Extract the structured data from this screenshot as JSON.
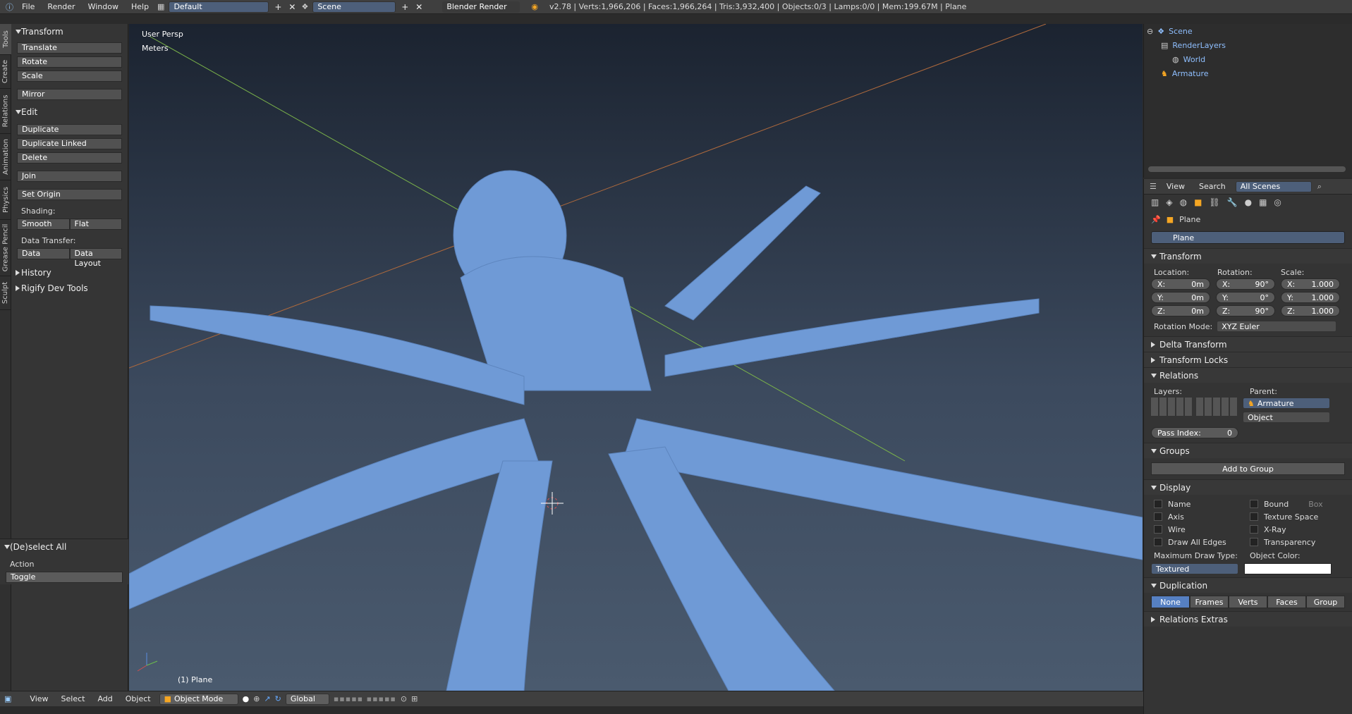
{
  "topbar": {
    "menus": [
      "File",
      "Render",
      "Window",
      "Help"
    ],
    "screen_layout": "Default",
    "scene": "Scene",
    "engine": "Blender Render",
    "stats": "v2.78 | Verts:1,966,206 | Faces:1,966,264 | Tris:3,932,400 | Objects:0/3 | Lamps:0/0 | Mem:199.67M | Plane"
  },
  "tabs": [
    "Tools",
    "Create",
    "Relations",
    "Animation",
    "Physics",
    "Grease Pencil",
    "Sculpt"
  ],
  "toolshelf": {
    "transform_title": "Transform",
    "translate": "Translate",
    "rotate": "Rotate",
    "scale": "Scale",
    "mirror": "Mirror",
    "edit_title": "Edit",
    "duplicate": "Duplicate",
    "duplicate_linked": "Duplicate Linked",
    "delete": "Delete",
    "join": "Join",
    "set_origin": "Set Origin",
    "shading_label": "Shading:",
    "smooth": "Smooth",
    "flat": "Flat",
    "data_transfer_label": "Data Transfer:",
    "data": "Data",
    "data_layout": "Data Layout",
    "history": "History",
    "rigify": "Rigify Dev Tools",
    "deselect_title": "(De)select All",
    "action_label": "Action",
    "action_value": "Toggle"
  },
  "viewport": {
    "view_name": "User Persp",
    "units": "Meters",
    "object_label": "(1) Plane"
  },
  "bottombar": {
    "menus": [
      "View",
      "Select",
      "Add",
      "Object"
    ],
    "mode": "Object Mode",
    "orientation": "Global"
  },
  "outliner": {
    "items": [
      "Scene",
      "RenderLayers",
      "World",
      "Armature"
    ]
  },
  "props": {
    "view": "View",
    "search": "Search",
    "scenes": "All Scenes",
    "context_object": "Plane",
    "object_name": "Plane",
    "transform": "Transform",
    "location_label": "Location:",
    "rotation_label": "Rotation:",
    "scale_label": "Scale:",
    "loc": [
      {
        "axis": "X:",
        "val": "0m"
      },
      {
        "axis": "Y:",
        "val": "0m"
      },
      {
        "axis": "Z:",
        "val": "0m"
      }
    ],
    "rot": [
      {
        "axis": "X:",
        "val": "90°"
      },
      {
        "axis": "Y:",
        "val": "0°"
      },
      {
        "axis": "Z:",
        "val": "90°"
      }
    ],
    "scl": [
      {
        "axis": "X:",
        "val": "1.000"
      },
      {
        "axis": "Y:",
        "val": "1.000"
      },
      {
        "axis": "Z:",
        "val": "1.000"
      }
    ],
    "rotation_mode_label": "Rotation Mode:",
    "rotation_mode": "XYZ Euler",
    "delta_transform": "Delta Transform",
    "transform_locks": "Transform Locks",
    "relations": "Relations",
    "layers_label": "Layers:",
    "parent_label": "Parent:",
    "parent_value": "Armature",
    "parent_type": "Object",
    "pass_index_label": "Pass Index:",
    "pass_index_value": "0",
    "groups": "Groups",
    "add_to_group": "Add to Group",
    "display": "Display",
    "name_chk": "Name",
    "axis_chk": "Axis",
    "wire_chk": "Wire",
    "draw_all_edges": "Draw All Edges",
    "bound_chk": "Bound",
    "bound_type": "Box",
    "texture_space": "Texture Space",
    "xray": "X-Ray",
    "transparency": "Transparency",
    "max_draw_label": "Maximum Draw Type:",
    "max_draw_value": "Textured",
    "object_color_label": "Object Color:",
    "object_color": "#ffffff",
    "duplication": "Duplication",
    "dup_options": [
      "None",
      "Frames",
      "Verts",
      "Faces",
      "Group"
    ],
    "relations_extras": "Relations Extras"
  }
}
